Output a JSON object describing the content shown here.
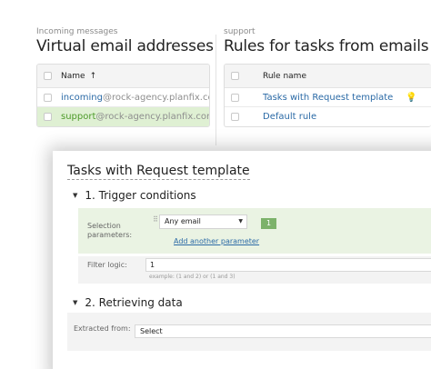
{
  "incoming": {
    "section_label": "Incoming messages",
    "title": "Virtual email addresses",
    "header": {
      "name_label": "Name",
      "sort_icon": "arrow-up-icon",
      "sort_glyph": "↑"
    },
    "rows": [
      {
        "user": "incoming",
        "domain": "@rock-agency.planfix.com",
        "selected": false
      },
      {
        "user": "support",
        "domain": "@rock-agency.planfix.com",
        "selected": true
      }
    ]
  },
  "support": {
    "section_label": "support",
    "title": "Rules for tasks from emails",
    "header": {
      "name_label": "Rule name"
    },
    "rows": [
      {
        "name": "Tasks with Request template",
        "icon": "lightbulb-icon",
        "icon_glyph": "💡"
      },
      {
        "name": "Default rule"
      }
    ]
  },
  "dialog": {
    "title": "Tasks with Request template",
    "trigger": {
      "heading": "1. Trigger conditions",
      "selection_label": "Selection parameters:",
      "selection_value": "Any email",
      "badge": "1",
      "add_param": "Add another parameter",
      "filter_label": "Filter logic:",
      "filter_value": "1",
      "filter_hint": "example: (1 and 2) or (1 and 3)"
    },
    "retrieving": {
      "heading": "2. Retrieving data",
      "extracted_label": "Extracted from:",
      "extracted_value": "Select"
    }
  },
  "colors": {
    "link": "#2b6aa6",
    "selected_row": "#dff0d3",
    "badge": "#7cb26a",
    "param_block": "#eaf3e3",
    "bulb": "#f2b92d"
  }
}
